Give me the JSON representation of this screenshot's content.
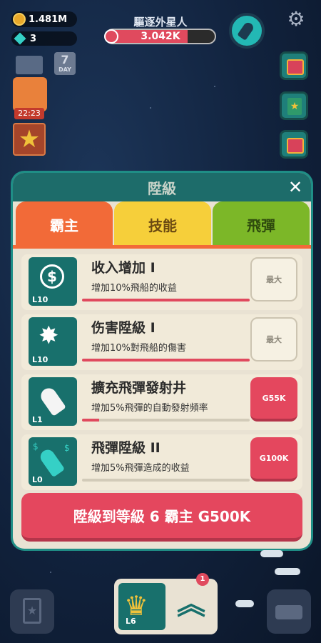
{
  "hud": {
    "coins": "1.481M",
    "gems": "3",
    "boss_title": "驅逐外星人",
    "boss_value": "3.042K",
    "boss_progress": 0.75,
    "calendar_label": "7",
    "calendar_sub": "DAY",
    "gift_timer": "22:23"
  },
  "icons": {
    "settings": "gear-icon",
    "mail": "mail-icon",
    "calendar": "calendar-icon",
    "gift": "gift-icon",
    "star": "star-icon",
    "radar": "rocket-radar-icon",
    "chest": "treasure-chest-icon",
    "book": "star-book-icon",
    "close": "close-icon"
  },
  "panel": {
    "title": "陞級",
    "close_label": "✕",
    "tabs": [
      {
        "label": "霸主",
        "color": "#f26a38",
        "text_color": "#ffffff"
      },
      {
        "label": "技能",
        "color": "#f6cf3a",
        "text_color": "#6b4a12"
      },
      {
        "label": "飛彈",
        "color": "#7cb728",
        "text_color": "#2f4b0e"
      }
    ],
    "rows": [
      {
        "level": "L10",
        "title": "收入增加 I",
        "desc": "增加10%飛船的收益",
        "progress": 1.0,
        "button": "最大",
        "state": "max"
      },
      {
        "level": "L10",
        "title": "伤害陞級 I",
        "desc": "增加10%對飛船的傷害",
        "progress": 1.0,
        "button": "最大",
        "state": "max"
      },
      {
        "level": "L1",
        "title": "擴充飛彈發射井",
        "desc": "增加5%飛彈的自動發射頻率",
        "progress": 0.1,
        "button": "G55K",
        "state": "cost"
      },
      {
        "level": "L0",
        "title": "飛彈陞級 II",
        "desc": "增加5%飛彈造成的收益",
        "progress": 0.0,
        "button": "G100K",
        "state": "cost"
      }
    ],
    "upgrade_button": "陞級到等級 6 霸主 G500K"
  },
  "bottom": {
    "crown_level": "L6",
    "badge": "1"
  },
  "colors": {
    "accent": "#e4475e",
    "teal": "#18706c",
    "panel_bg": "#e9e2d3"
  }
}
